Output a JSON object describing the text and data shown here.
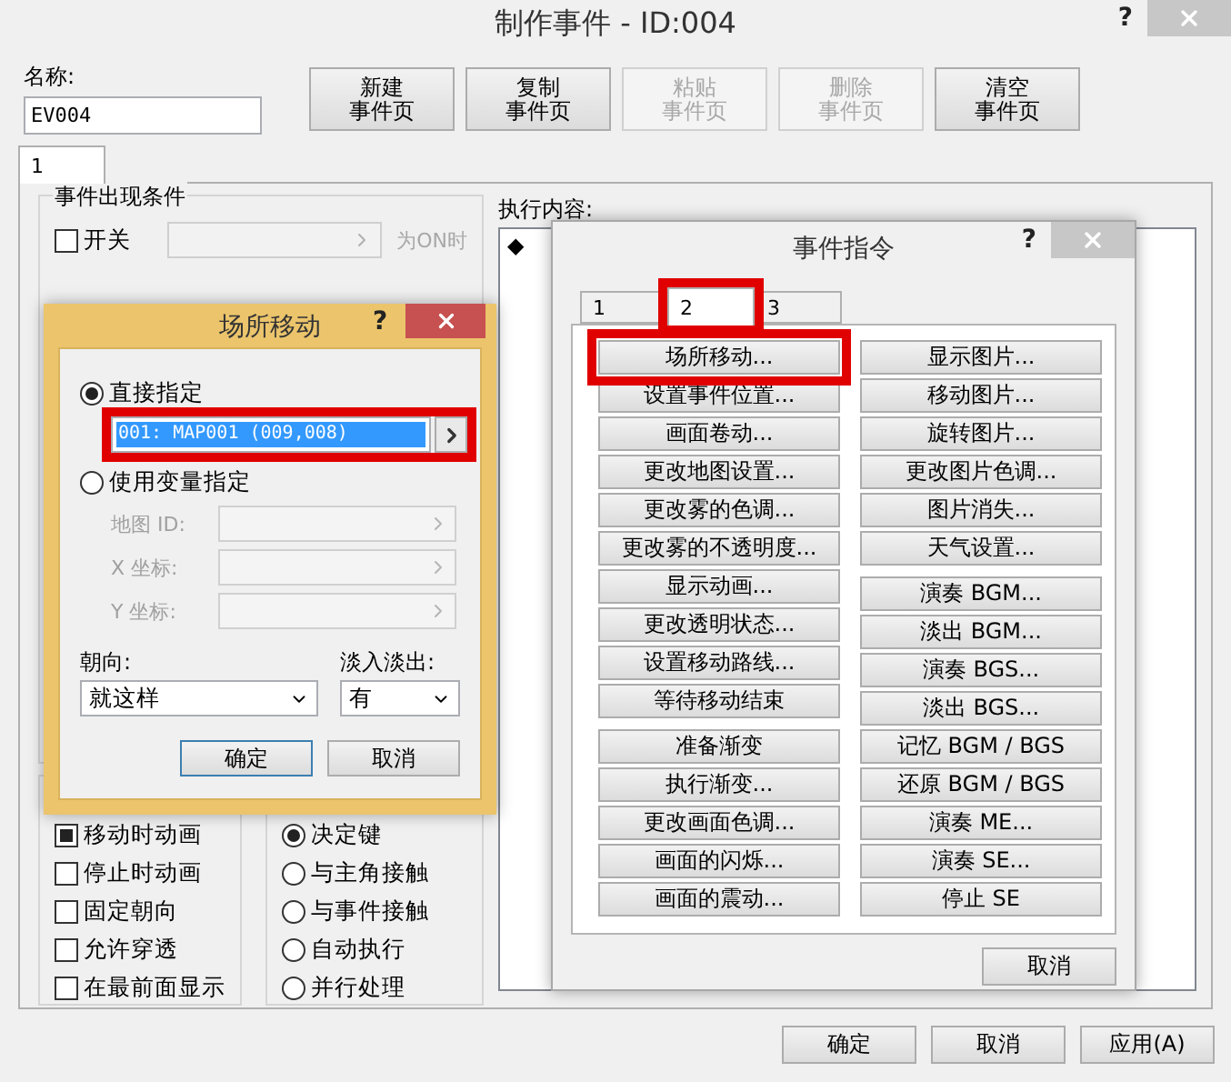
{
  "window": {
    "title": "制作事件 - ID:004",
    "help": "?"
  },
  "name_field": {
    "label": "名称:",
    "value": "EV004"
  },
  "page_buttons": [
    {
      "lines": [
        "新建",
        "事件页"
      ],
      "disabled": false
    },
    {
      "lines": [
        "复制",
        "事件页"
      ],
      "disabled": false
    },
    {
      "lines": [
        "粘贴",
        "事件页"
      ],
      "disabled": true
    },
    {
      "lines": [
        "删除",
        "事件页"
      ],
      "disabled": true
    },
    {
      "lines": [
        "清空",
        "事件页"
      ],
      "disabled": false
    }
  ],
  "page_tabs": [
    {
      "label": "1",
      "selected": true
    }
  ],
  "conditions": {
    "title": "事件出现条件",
    "rows": [
      {
        "label": "开关",
        "checked": false,
        "suffix": "为ON时"
      }
    ]
  },
  "options": [
    {
      "label": "移动时动画",
      "checked": true
    },
    {
      "label": "停止时动画",
      "checked": false
    },
    {
      "label": "固定朝向",
      "checked": false
    },
    {
      "label": "允许穿透",
      "checked": false
    },
    {
      "label": "在最前面显示",
      "checked": false
    }
  ],
  "triggers": [
    {
      "label": "决定键",
      "selected": true
    },
    {
      "label": "与主角接触",
      "selected": false
    },
    {
      "label": "与事件接触",
      "selected": false
    },
    {
      "label": "自动执行",
      "selected": false
    },
    {
      "label": "并行处理",
      "selected": false
    }
  ],
  "contents": {
    "label": "执行内容:",
    "lines": [
      "◆"
    ]
  },
  "footer_buttons": [
    "确定",
    "取消",
    "应用(A)"
  ],
  "command_dialog": {
    "title": "事件指令",
    "help": "?",
    "tabs": [
      {
        "label": "1",
        "selected": false,
        "highlighted": false
      },
      {
        "label": "2",
        "selected": true,
        "highlighted": true
      },
      {
        "label": "3",
        "selected": false,
        "highlighted": false
      }
    ],
    "columns": [
      {
        "groups": [
          [
            {
              "label": "场所移动...",
              "highlighted": true
            },
            {
              "label": "设置事件位置...",
              "highlighted": false
            },
            {
              "label": "画面卷动...",
              "highlighted": false
            },
            {
              "label": "更改地图设置...",
              "highlighted": false
            },
            {
              "label": "更改雾的色调...",
              "highlighted": false
            },
            {
              "label": "更改雾的不透明度...",
              "highlighted": false
            },
            {
              "label": "显示动画...",
              "highlighted": false
            },
            {
              "label": "更改透明状态...",
              "highlighted": false
            },
            {
              "label": "设置移动路线...",
              "highlighted": false
            },
            {
              "label": "等待移动结束",
              "highlighted": false
            }
          ],
          [
            {
              "label": "准备渐变",
              "highlighted": false
            },
            {
              "label": "执行渐变...",
              "highlighted": false
            },
            {
              "label": "更改画面色调...",
              "highlighted": false
            },
            {
              "label": "画面的闪烁...",
              "highlighted": false
            },
            {
              "label": "画面的震动...",
              "highlighted": false
            }
          ]
        ]
      },
      {
        "groups": [
          [
            {
              "label": "显示图片...",
              "highlighted": false
            },
            {
              "label": "移动图片...",
              "highlighted": false
            },
            {
              "label": "旋转图片...",
              "highlighted": false
            },
            {
              "label": "更改图片色调...",
              "highlighted": false
            },
            {
              "label": "图片消失...",
              "highlighted": false
            },
            {
              "label": "天气设置...",
              "highlighted": false
            }
          ],
          [
            {
              "label": "演奏 BGM...",
              "highlighted": false
            },
            {
              "label": "淡出 BGM...",
              "highlighted": false
            },
            {
              "label": "演奏 BGS...",
              "highlighted": false
            },
            {
              "label": "淡出 BGS...",
              "highlighted": false
            },
            {
              "label": "记忆 BGM / BGS",
              "highlighted": false
            },
            {
              "label": "还原 BGM / BGS",
              "highlighted": false
            },
            {
              "label": "演奏 ME...",
              "highlighted": false
            },
            {
              "label": "演奏 SE...",
              "highlighted": false
            },
            {
              "label": "停止 SE",
              "highlighted": false
            }
          ]
        ]
      }
    ],
    "cancel": "取消"
  },
  "transfer_dialog": {
    "title": "场所移动",
    "help": "?",
    "direct": {
      "label": "直接指定",
      "selected": true,
      "value": "001: MAP001 (009,008)",
      "highlighted": true
    },
    "variable": {
      "label": "使用变量指定",
      "selected": false,
      "fields": [
        {
          "label": "地图 ID:"
        },
        {
          "label": "X 坐标:"
        },
        {
          "label": "Y 坐标:"
        }
      ]
    },
    "direction": {
      "label": "朝向:",
      "value": "就这样"
    },
    "fade": {
      "label": "淡入淡出:",
      "value": "有"
    },
    "buttons": [
      {
        "label": "确定",
        "default": true
      },
      {
        "label": "取消",
        "default": false
      }
    ]
  }
}
